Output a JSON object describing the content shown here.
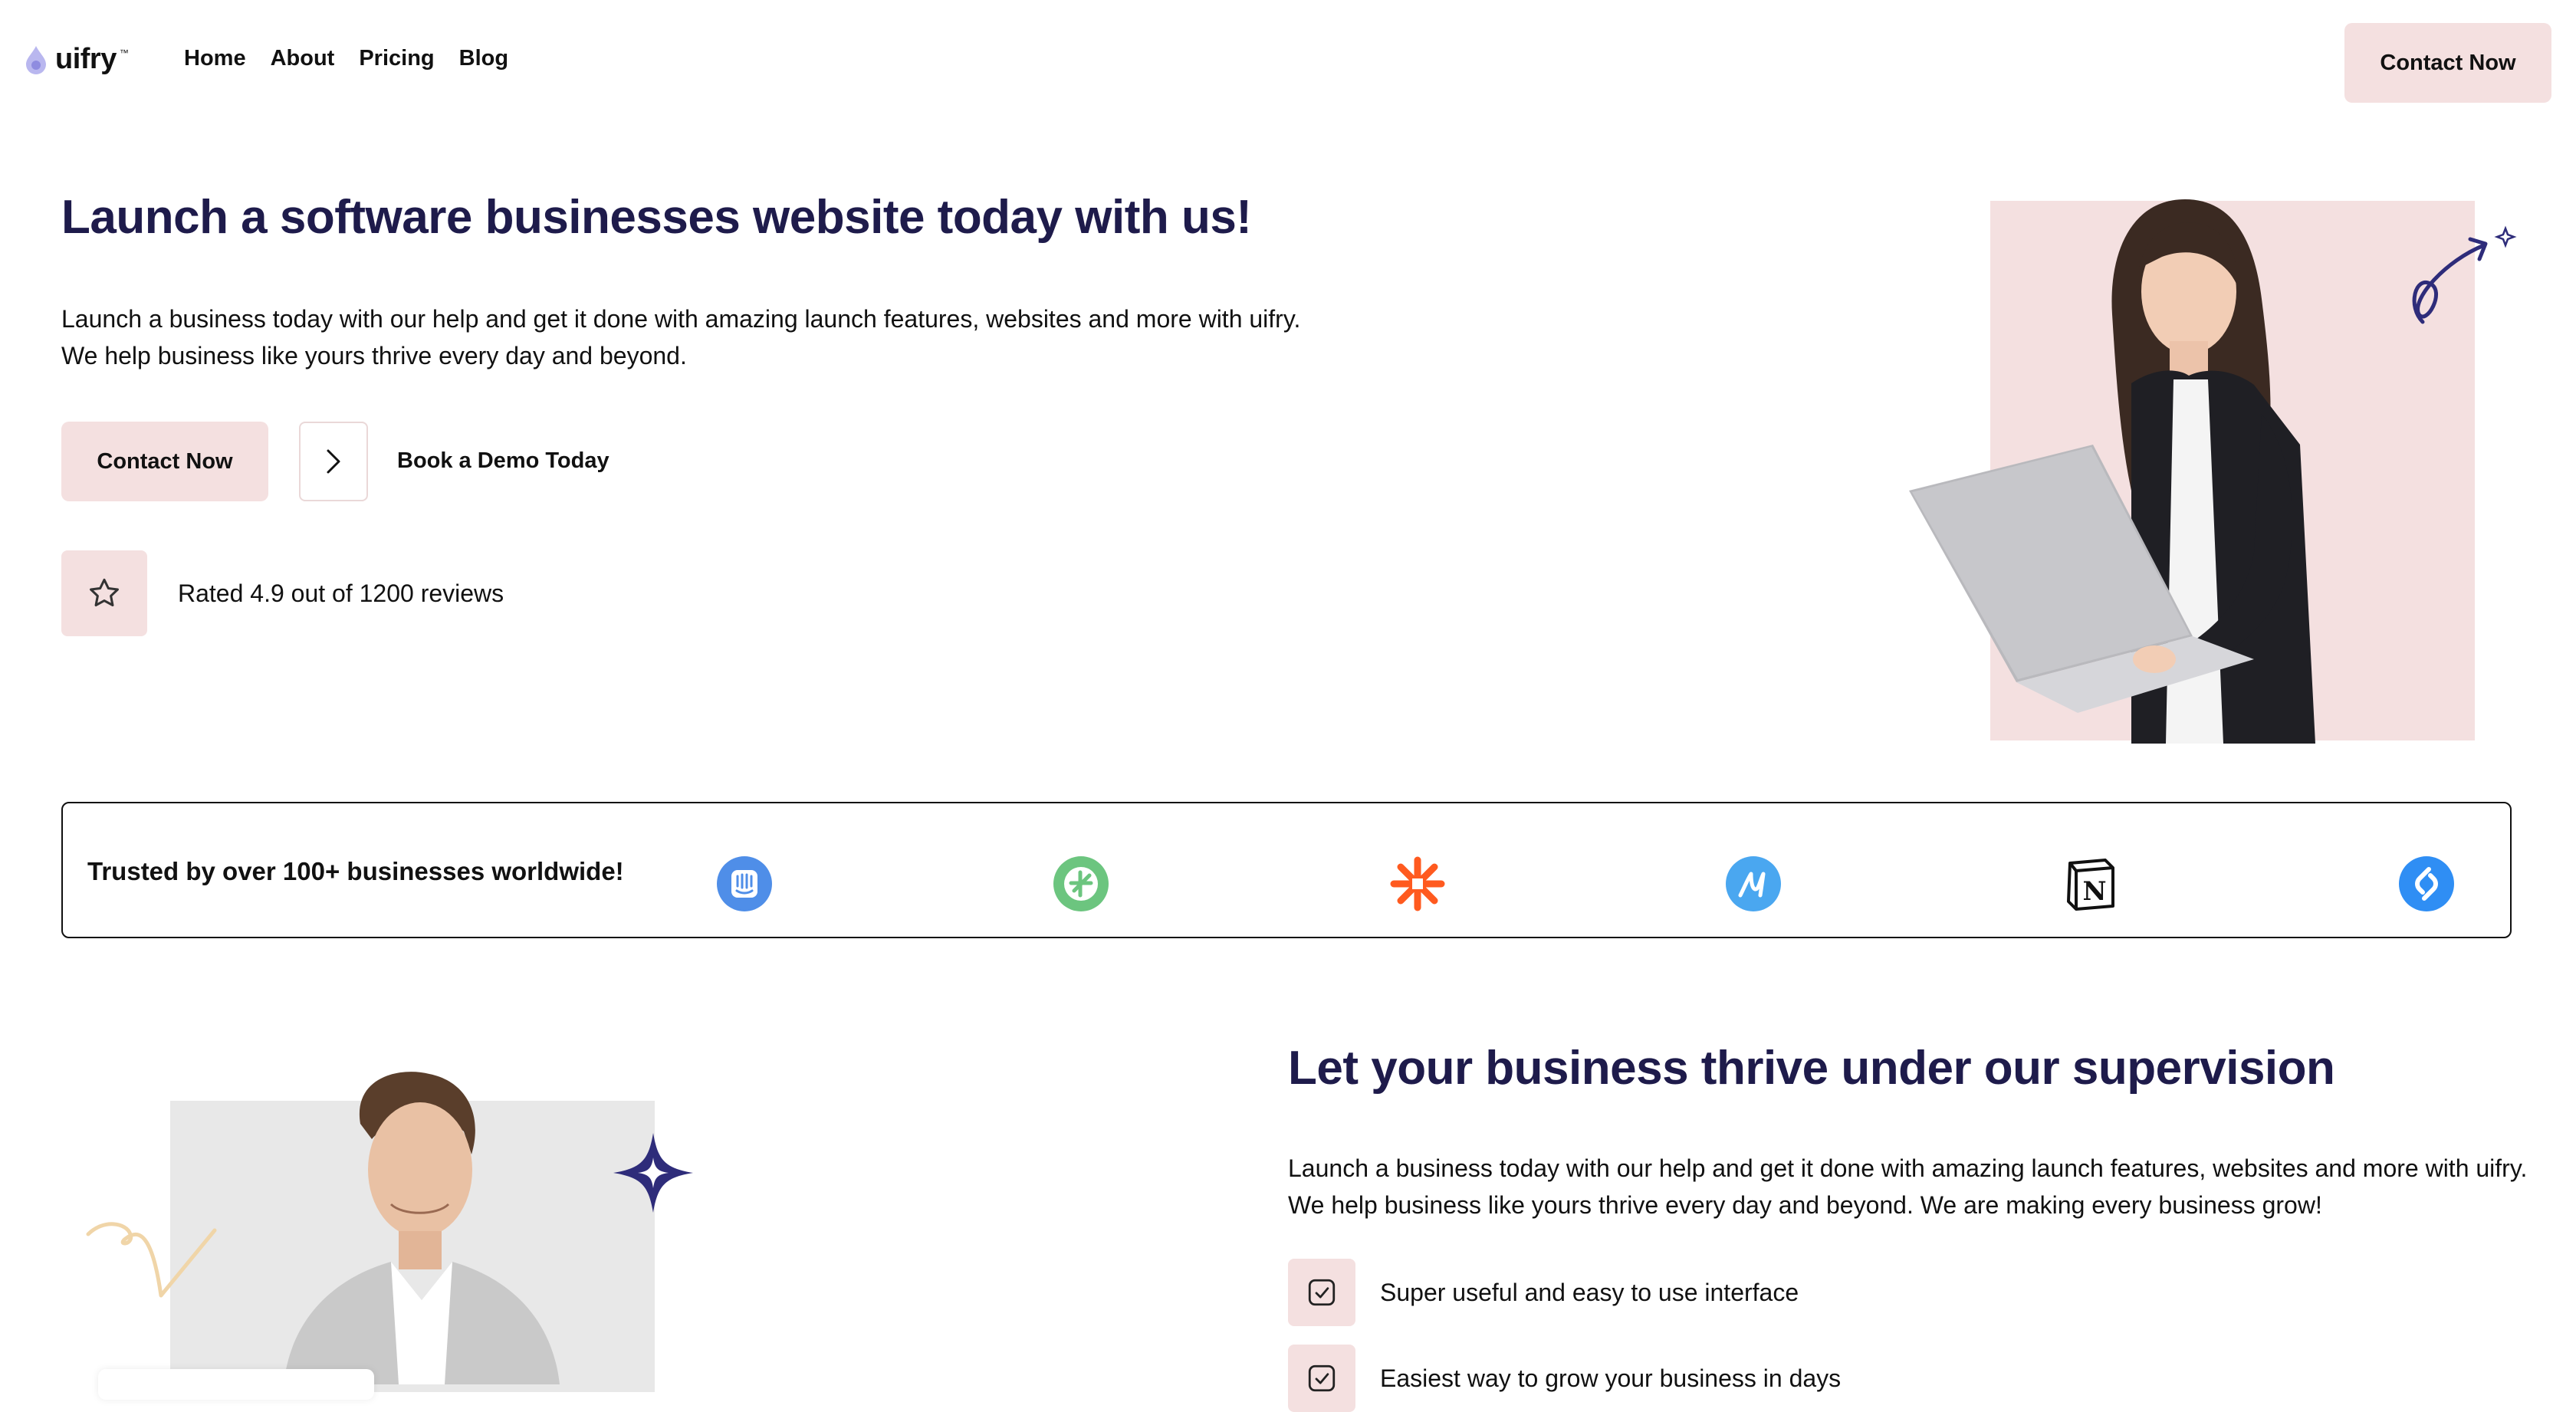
{
  "nav": {
    "logo_text": "uifry",
    "logo_tm": "™",
    "links": [
      "Home",
      "About",
      "Pricing",
      "Blog"
    ],
    "cta": "Contact Now"
  },
  "hero": {
    "title": "Launch a software businesses website today with us!",
    "body": "Launch a business today with our help and get it done with amazing launch features, websites and more with uifry. We help business like yours thrive every day and beyond.",
    "primary_cta": "Contact Now",
    "secondary_cta": "Book a Demo Today",
    "rating": "Rated 4.9 out of 1200 reviews"
  },
  "trusted": {
    "text": "Trusted by over 100+ businesses worldwide!",
    "brands": [
      "intercom-icon",
      "tripadvisor-icon",
      "zapier-icon",
      "maze-icon",
      "notion-icon",
      "shazam-icon"
    ]
  },
  "section2": {
    "title": "Let your business thrive under our supervision",
    "body": "Launch a business today with our help and get it done with amazing launch features, websites and more with uifry. We help business like yours thrive every day and beyond. We are making every business grow!",
    "features": [
      "Super useful and easy to use interface",
      "Easiest way to grow your business in days"
    ]
  },
  "colors": {
    "accent_pink": "#f4e0e0",
    "heading_navy": "#1e1b4b",
    "logo_purple": "#a5a3e6"
  }
}
